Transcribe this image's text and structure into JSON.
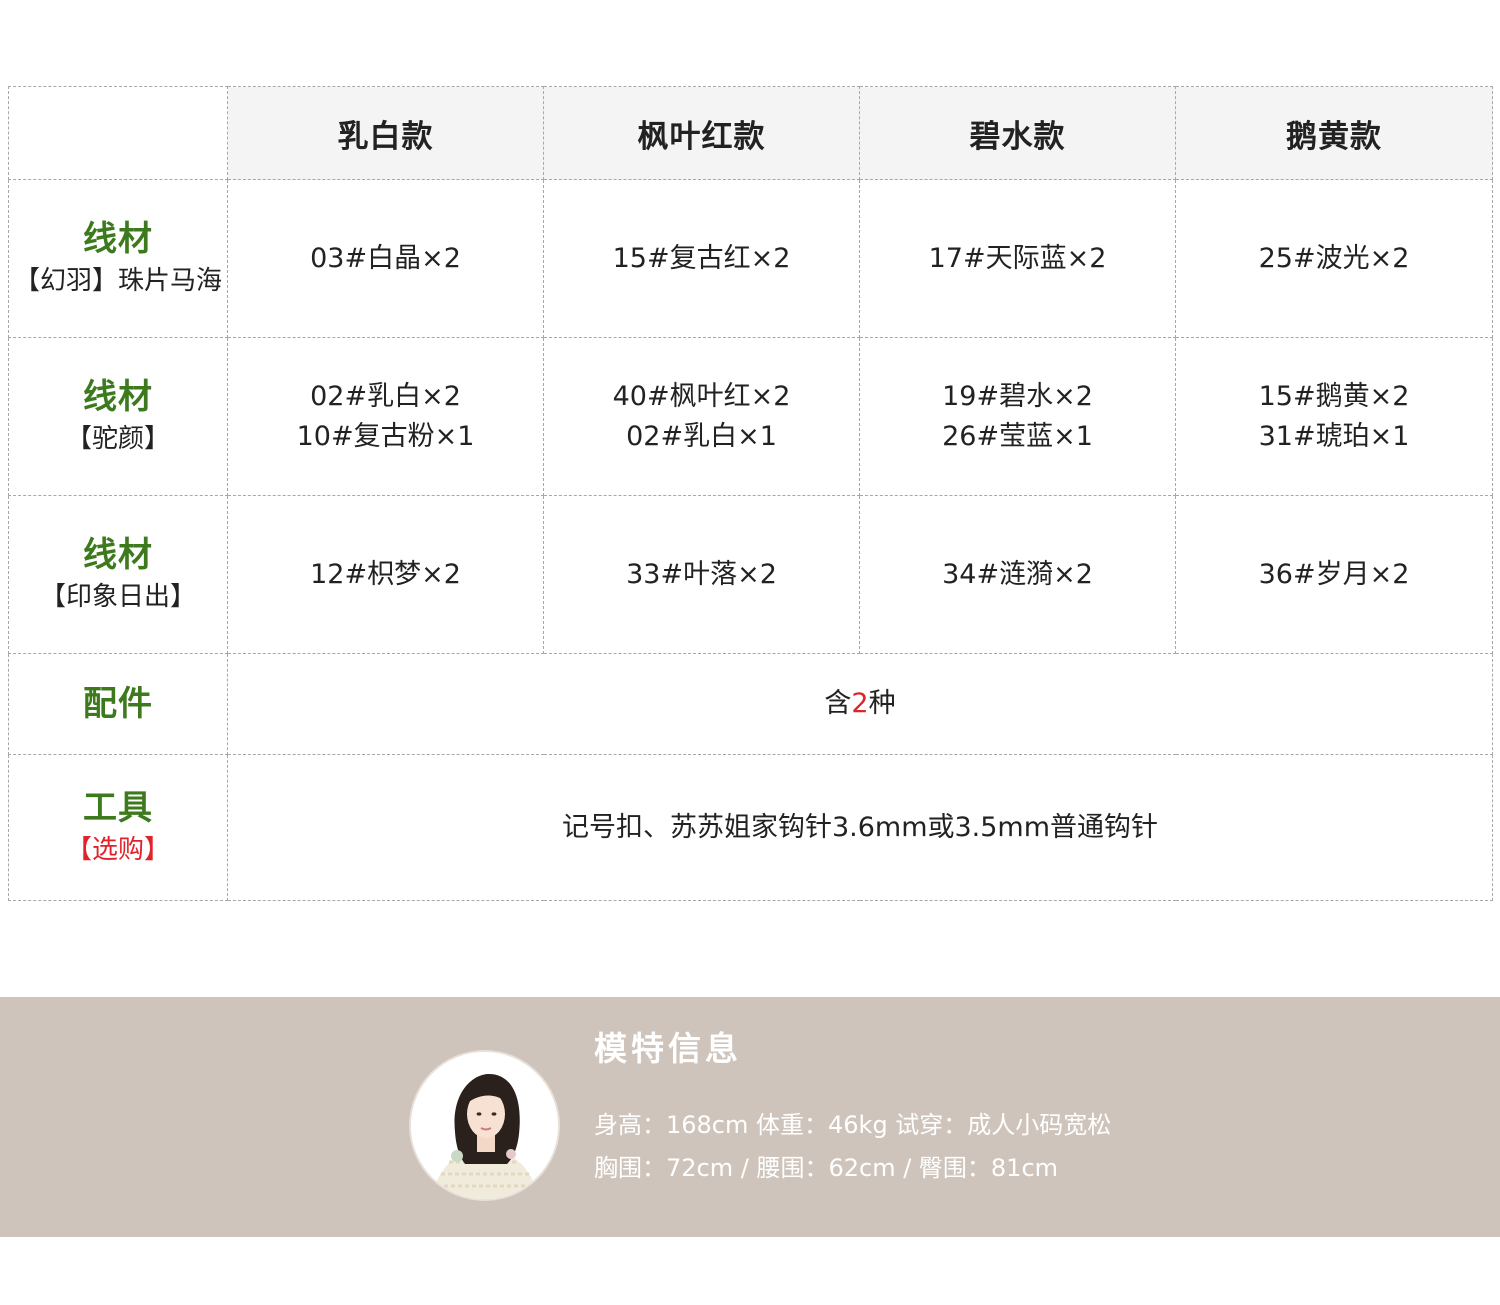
{
  "table": {
    "columns": [
      "乳白款",
      "枫叶红款",
      "碧水款",
      "鹅黄款"
    ],
    "rows": [
      {
        "title": "线材",
        "subtitle": "【幻羽】珠片马海",
        "cells": [
          [
            "03#白晶×2"
          ],
          [
            "15#复古红×2"
          ],
          [
            "17#天际蓝×2"
          ],
          [
            "25#波光×2"
          ]
        ]
      },
      {
        "title": "线材",
        "subtitle": "【驼颜】",
        "cells": [
          [
            "02#乳白×2",
            "10#复古粉×1"
          ],
          [
            "40#枫叶红×2",
            "02#乳白×1"
          ],
          [
            "19#碧水×2",
            "26#莹蓝×1"
          ],
          [
            "15#鹅黄×2",
            "31#琥珀×1"
          ]
        ]
      },
      {
        "title": "线材",
        "subtitle": "【印象日出】",
        "cells": [
          [
            "12#枳梦×2"
          ],
          [
            "33#叶落×2"
          ],
          [
            "34#涟漪×2"
          ],
          [
            "36#岁月×2"
          ]
        ]
      }
    ],
    "accessories": {
      "title": "配件",
      "prefix": "含",
      "count": "2",
      "suffix": "种"
    },
    "tools": {
      "title": "工具",
      "subtitle": "【选购】",
      "text": "记号扣、苏苏姐家钩针3.6mm或3.5mm普通钩针"
    }
  },
  "model": {
    "title": "模特信息",
    "line1": "身高：168cm  体重：46kg  试穿：成人小码宽松",
    "line2": "胸围：72cm / 腰围：62cm / 臀围：81cm"
  },
  "colors": {
    "title_green": "#3d7a1e",
    "accent_red": "#e0232a",
    "banner_bg": "#cfc4bb",
    "header_bg": "#f4f4f4"
  }
}
